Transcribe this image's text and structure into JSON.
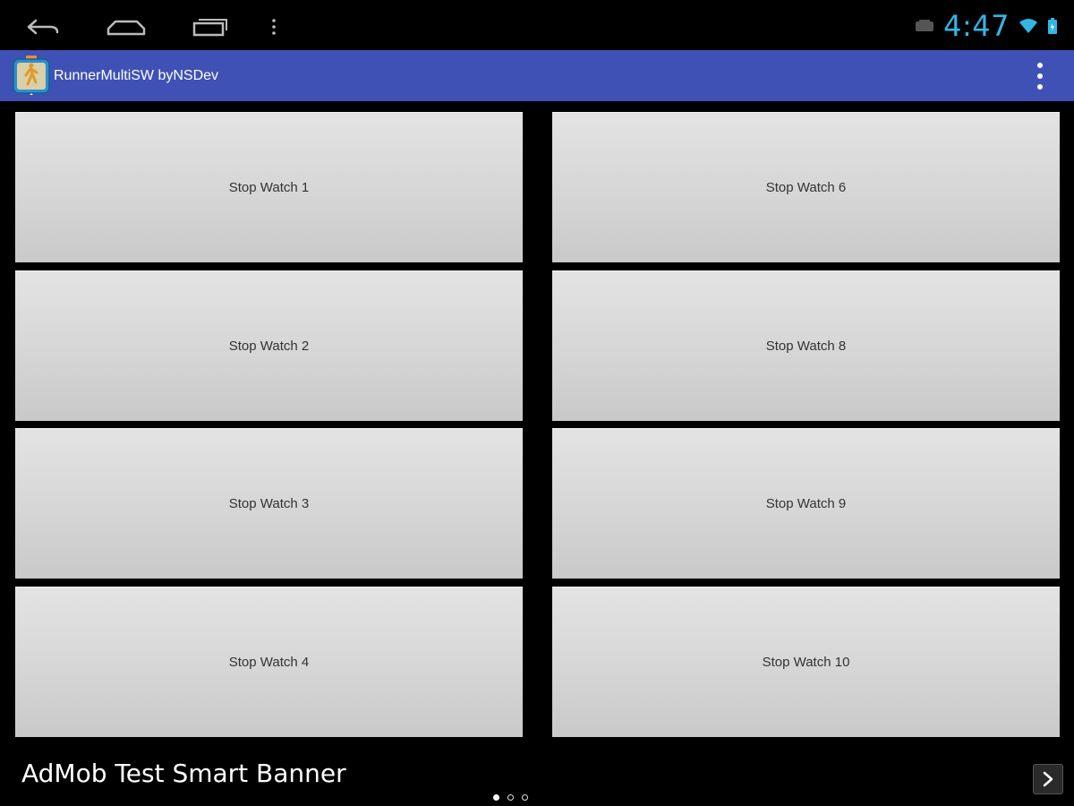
{
  "status_bar": {
    "time": "4:47",
    "icons": [
      "back-icon",
      "home-icon",
      "recent-apps-icon",
      "menu-dots-icon",
      "notification-icon",
      "wifi-icon",
      "battery-icon"
    ]
  },
  "action_bar": {
    "title": "RunnerMultiSW byNSDev",
    "color": "#3f51b5"
  },
  "stopwatches": {
    "left": [
      "Stop Watch 1",
      "Stop Watch 2",
      "Stop Watch 3",
      "Stop Watch 4"
    ],
    "right": [
      "Stop Watch 6",
      "Stop Watch 8",
      "Stop Watch 9",
      "Stop Watch 10"
    ]
  },
  "banner": {
    "text": "AdMob Test Smart Banner",
    "page_count": 3,
    "active_page": 1
  },
  "colors": {
    "clock": "#33b5e5",
    "button_face": "#d7d7d7"
  }
}
